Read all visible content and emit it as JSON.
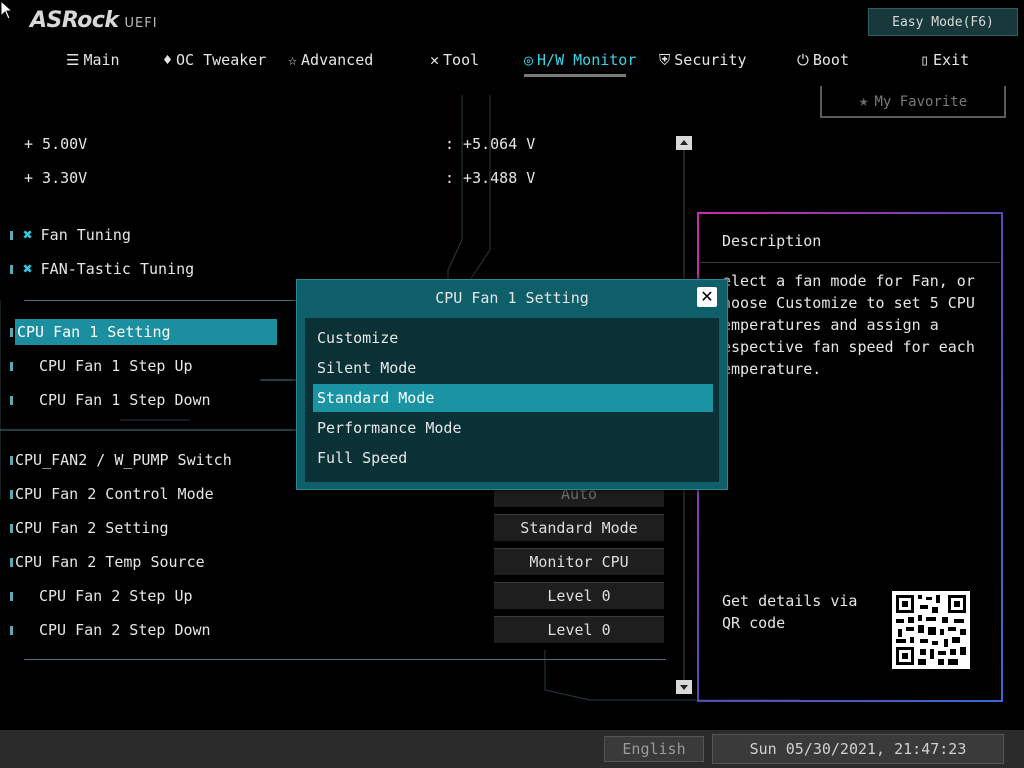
{
  "brand": {
    "name": "ASRock",
    "suffix": "UEFI"
  },
  "easy_mode_label": "Easy Mode(F6)",
  "tabs": [
    {
      "label": "Main",
      "icon": "list-icon"
    },
    {
      "label": "OC Tweaker",
      "icon": "rocket-icon"
    },
    {
      "label": "Advanced",
      "icon": "star-outline-icon"
    },
    {
      "label": "Tool",
      "icon": "tools-icon"
    },
    {
      "label": "H/W Monitor",
      "icon": "globe-icon",
      "active": true
    },
    {
      "label": "Security",
      "icon": "shield-icon"
    },
    {
      "label": "Boot",
      "icon": "power-icon"
    },
    {
      "label": "Exit",
      "icon": "exit-door-icon"
    }
  ],
  "favorite_label": "My Favorite",
  "voltages": [
    {
      "label": "+ 5.00V",
      "value": ": +5.064 V"
    },
    {
      "label": "+ 3.30V",
      "value": ": +3.488 V"
    }
  ],
  "menu": {
    "fan_tuning": "Fan Tuning",
    "fantastic_tuning": "FAN-Tastic Tuning",
    "cpu_fan1_setting": "CPU Fan 1 Setting",
    "cpu_fan1_step_up": "CPU Fan 1 Step Up",
    "cpu_fan1_step_down": "CPU Fan 1 Step Down",
    "cpu_fan2_pump_switch": "CPU_FAN2 / W_PUMP Switch",
    "cpu_fan2_control_mode": "CPU Fan 2 Control Mode",
    "cpu_fan2_setting": "CPU Fan 2 Setting",
    "cpu_fan2_temp_source": "CPU Fan 2 Temp Source",
    "cpu_fan2_step_up": "CPU Fan 2 Step Up",
    "cpu_fan2_step_down": "CPU Fan 2 Step Down"
  },
  "values": {
    "cpu_fan2_control_mode": "Auto",
    "cpu_fan2_setting": "Standard Mode",
    "cpu_fan2_temp_source": "Monitor CPU",
    "cpu_fan2_step_up": "Level 0",
    "cpu_fan2_step_down": "Level 0"
  },
  "description": {
    "title": "Description",
    "text": "elect a fan mode for Fan, or\nhoose Customize to set 5 CPU\nemperatures and assign a\nespective fan speed for each\nemperature.",
    "qr_text": "Get details via QR code"
  },
  "modal": {
    "title": "CPU Fan 1 Setting",
    "options": [
      "Customize",
      "Silent Mode",
      "Standard Mode",
      "Performance Mode",
      "Full Speed"
    ],
    "selected": "Standard Mode"
  },
  "footer": {
    "language": "English",
    "datetime": "Sun 05/30/2021, 21:47:23"
  },
  "colors": {
    "accent": "#33d6e6",
    "selection": "#1b8ea0",
    "modal_bg": "#0e5f6a"
  }
}
